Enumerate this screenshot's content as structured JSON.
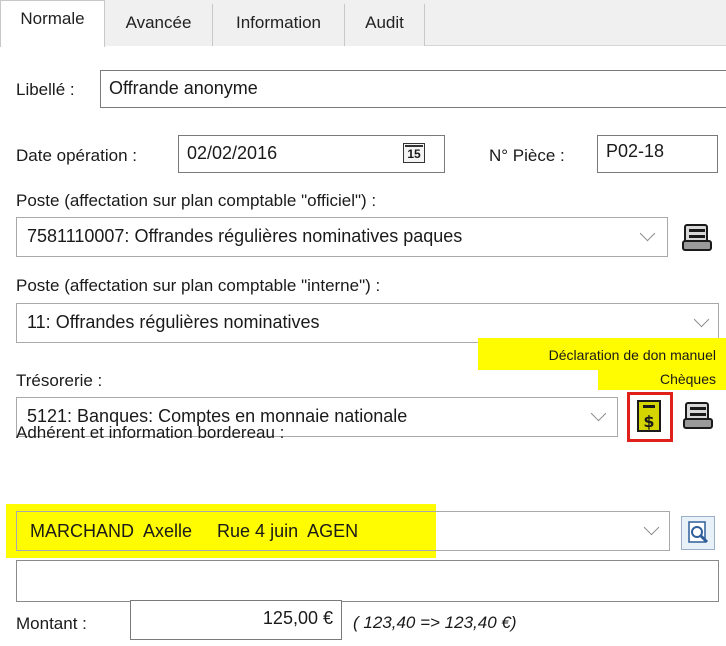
{
  "tabs": [
    {
      "label": "Normale",
      "active": true
    },
    {
      "label": "Avancée",
      "active": false
    },
    {
      "label": "Information",
      "active": false
    },
    {
      "label": "Audit",
      "active": false
    }
  ],
  "libelle": {
    "label": "Libellé :",
    "value": "Offrande anonyme"
  },
  "date_operation": {
    "label": "Date opération :",
    "value": "02/02/2016",
    "calendar_day": "15",
    "icon": "calendar-icon"
  },
  "piece": {
    "label": "N° Pièce :",
    "value": "P02-18"
  },
  "poste_officiel": {
    "label": "Poste (affectation sur plan comptable \"officiel\") :",
    "value": "7581110007: Offrandes régulières nominatives paques",
    "icon": "ledger-icon"
  },
  "poste_interne": {
    "label": "Poste (affectation sur plan comptable \"interne\") :",
    "value": "11: Offrandes régulières nominatives"
  },
  "tresorerie": {
    "label": "Trésorerie :",
    "value": "5121: Banques: Comptes en monnaie nationale",
    "annotation_line1": "Déclaration de don manuel",
    "annotation_line2": "Chèques",
    "icons": [
      "don-declaration-icon",
      "cheque-icon"
    ]
  },
  "adherent": {
    "label": "Adhérent et information bordereau :",
    "value": "MARCHAND  Axelle     Rue 4 juin  AGEN",
    "icon": "search-icon",
    "bordereau_value": ""
  },
  "montant": {
    "label": "Montant :",
    "value": "125,00 €",
    "detail": "( 123,40 => 123,40 €)"
  },
  "colors": {
    "highlight": "#fffb00",
    "annotation_border": "#e0201b"
  }
}
